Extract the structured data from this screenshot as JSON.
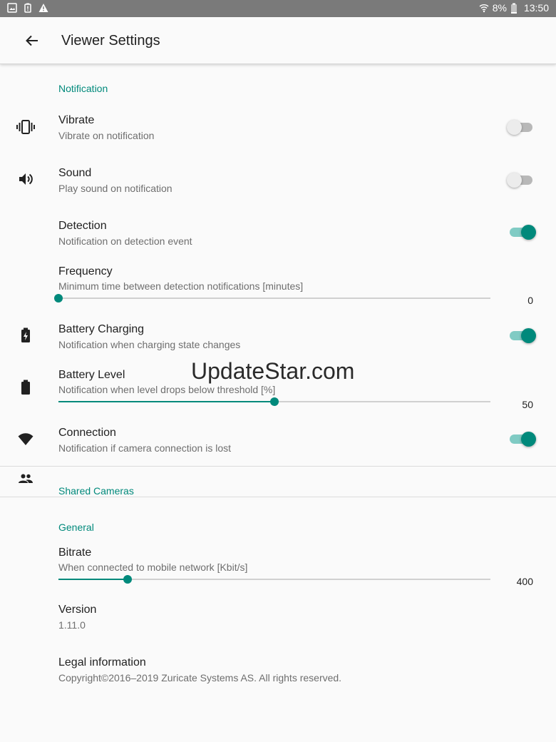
{
  "status_bar": {
    "battery_percent": "8%",
    "time": "13:50",
    "left_icons": [
      "image-icon",
      "battery-alert-icon",
      "warning-icon"
    ],
    "right_icons": [
      "wifi-icon",
      "battery-icon"
    ]
  },
  "app_bar": {
    "title": "Viewer Settings",
    "back_icon": "arrow-left-icon"
  },
  "notification": {
    "header": "Notification",
    "vibrate": {
      "title": "Vibrate",
      "subtitle": "Vibrate on notification",
      "enabled": false,
      "icon": "vibrate-icon"
    },
    "sound": {
      "title": "Sound",
      "subtitle": "Play sound on notification",
      "enabled": false,
      "icon": "speaker-icon"
    },
    "detection": {
      "title": "Detection",
      "subtitle": "Notification on detection event",
      "enabled": true
    },
    "frequency": {
      "title": "Frequency",
      "subtitle": "Minimum time between detection notifications [minutes]",
      "value": "0",
      "fraction": 0.0
    },
    "battery_charging": {
      "title": "Battery Charging",
      "subtitle": "Notification when charging state changes",
      "enabled": true,
      "icon": "battery-charging-icon"
    },
    "battery_level": {
      "title": "Battery Level",
      "subtitle": "Notification when level drops below threshold [%]",
      "value": "50",
      "fraction": 0.5,
      "icon": "battery-full-icon"
    },
    "connection": {
      "title": "Connection",
      "subtitle": "Notification if camera connection is lost",
      "enabled": true,
      "icon": "wifi-icon"
    }
  },
  "shared_cameras": {
    "header": "Shared Cameras",
    "icon": "people-icon"
  },
  "general": {
    "header": "General",
    "bitrate": {
      "title": "Bitrate",
      "subtitle": "When connected to mobile network [Kbit/s]",
      "value": "400",
      "fraction": 0.16
    },
    "version": {
      "title": "Version",
      "value": "1.11.0"
    },
    "legal": {
      "title": "Legal information",
      "subtitle": "Copyright©2016–2019 Zuricate Systems AS. All rights reserved."
    }
  },
  "watermark": "UpdateStar.com",
  "colors": {
    "accent": "#00897b",
    "accent_light": "#80cbc4",
    "status_bar": "#7a7a7a"
  }
}
